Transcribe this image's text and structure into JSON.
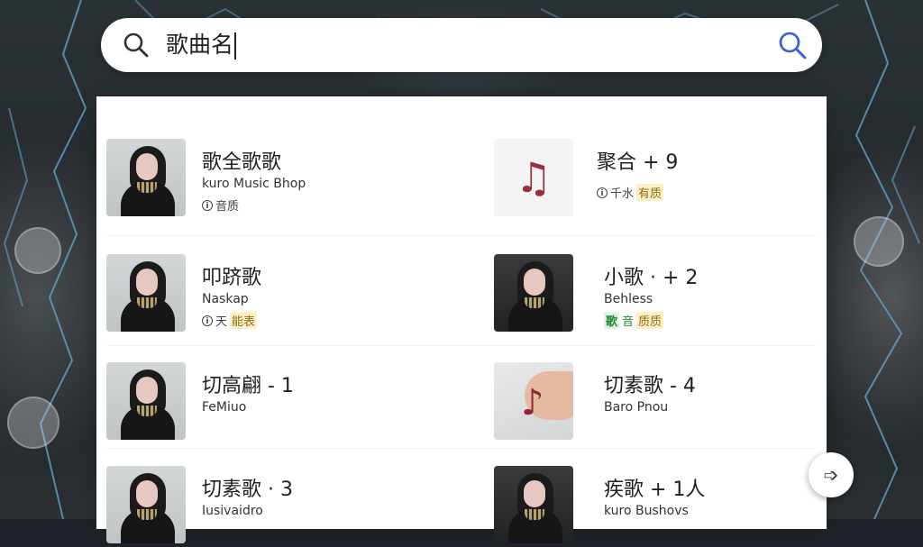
{
  "search": {
    "query": "歌曲名",
    "lens_icon": "search-icon",
    "go_icon": "search-icon"
  },
  "results": [
    {
      "title": "歌全歌歌",
      "subtitle": "kuro Music Bhop",
      "meta_icon": "info-circle-icon",
      "meta_text": "音质",
      "tag": "",
      "thumb": "portrait"
    },
    {
      "title": "聚合 + 9",
      "subtitle": "",
      "meta_icon": "info-circle-icon",
      "meta_text": "千水",
      "tag": "有质",
      "thumb": "note"
    },
    {
      "title": "叩跻歌",
      "subtitle": "Naskap",
      "meta_icon": "info-circle-icon",
      "meta_text": "天",
      "tag": "能表",
      "thumb": "portrait"
    },
    {
      "title": "小歌 · + 2",
      "subtitle": "Behless",
      "meta_icon": "badge-icon",
      "meta_text": "音",
      "tag_green": "歌",
      "tag": "质质",
      "thumb": "portrait-dark"
    },
    {
      "title": "切高翩 - 1",
      "subtitle": "FeMiuo",
      "meta_icon": "",
      "meta_text": "",
      "tag": "",
      "thumb": "portrait"
    },
    {
      "title": "切素歌 - 4",
      "subtitle": "Baro Pnou",
      "meta_icon": "",
      "meta_text": "",
      "tag": "",
      "thumb": "hand"
    },
    {
      "title": "切素歌 · 3",
      "subtitle": "Iusivaidro",
      "meta_icon": "",
      "meta_text": "",
      "tag": "",
      "thumb": "portrait"
    },
    {
      "title": "疾歌 + 1人",
      "subtitle": "kuro Bushovs",
      "meta_icon": "",
      "meta_text": "",
      "tag": "",
      "thumb": "portrait-dark"
    }
  ],
  "fab": {
    "icon": "share-arrow-icon",
    "glyph": "➩"
  },
  "colors": {
    "accent": "#3d63d6",
    "note": "#9b2d3f"
  }
}
